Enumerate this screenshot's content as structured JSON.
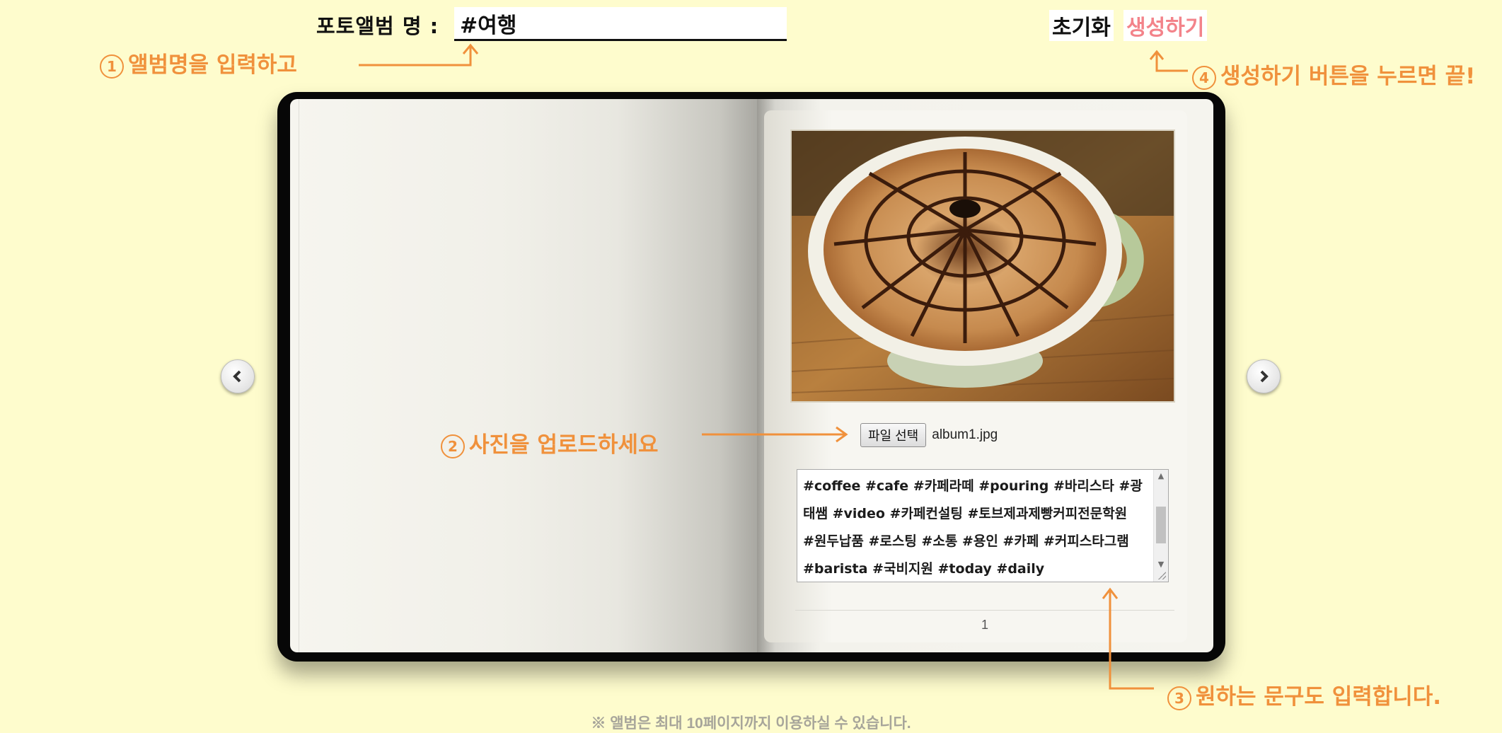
{
  "header": {
    "album_label": "포토앨범 명 :",
    "album_value": "#여행",
    "reset_label": "초기화",
    "create_label": "생성하기"
  },
  "hints": {
    "h1_num": "1",
    "h1_text": "앨범명을 입력하고",
    "h2_num": "2",
    "h2_text": "사진을 업로드하세요",
    "h3_num": "3",
    "h3_text": "원하는 문구도 입력합니다.",
    "h4_num": "4",
    "h4_text": "생성하기 버튼을 누르면 끝!"
  },
  "page": {
    "file_button": "파일 선택",
    "file_name": "album1.jpg",
    "caption": "#coffee #cafe #카페라떼 #pouring #바리스타 #광태쌤 #video #카페컨설팅 #토브제과제빵커피전문학원 #원두납품 #로스팅 #소통 #용인 #카페 #커피스타그램 #barista #국비지원 #today #daily",
    "page_number": "1"
  },
  "icons": {
    "prev": "chevron-left-icon",
    "next": "chevron-right-icon"
  },
  "footer": {
    "note": "※ 앨범은 최대 10페이지까지 이용하실 수 있습니다."
  },
  "colors": {
    "background": "#fefccd",
    "hint": "#f0913c",
    "create_button": "#f3838a"
  }
}
